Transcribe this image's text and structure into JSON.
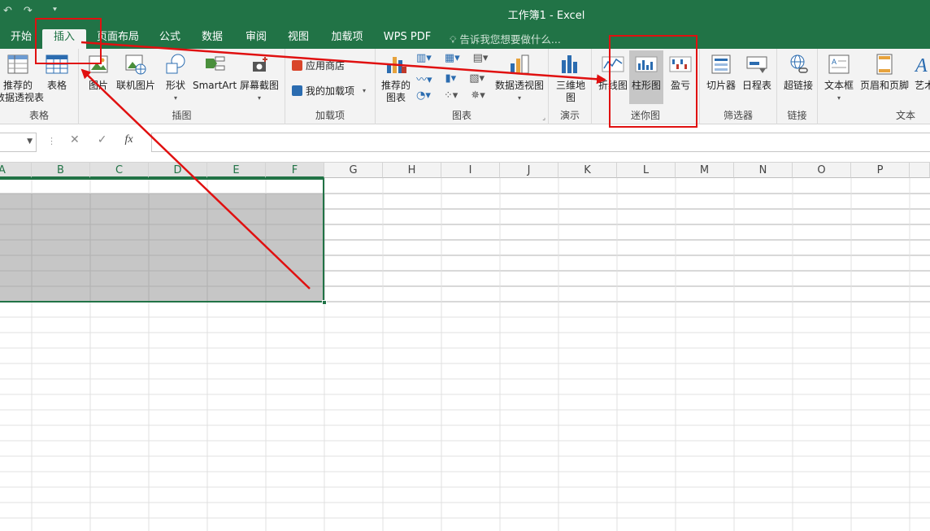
{
  "title": "工作簿1 - Excel",
  "qat": {
    "undo": "↶",
    "redo": "↷",
    "customize": "⯆"
  },
  "tabs": [
    "开始",
    "插入",
    "页面布局",
    "公式",
    "数据",
    "审阅",
    "视图",
    "加载项",
    "WPS PDF"
  ],
  "active_tab": "插入",
  "tell_me": "告诉我您想要做什么...",
  "ribbon": {
    "tables": {
      "label": "表格",
      "recommended_pivot": "推荐的\n数据透视表",
      "table": "表格"
    },
    "illustrations": {
      "label": "插图",
      "picture": "图片",
      "online_picture": "联机图片",
      "shapes": "形状",
      "smartart": "SmartArt",
      "screenshot": "屏幕截图"
    },
    "addins": {
      "label": "加载项",
      "store": "应用商店",
      "my_addins": "我的加载项"
    },
    "charts": {
      "label": "图表",
      "recommended": "推荐的\n图表",
      "pivot_chart": "数据透视图"
    },
    "tours": {
      "label": "演示",
      "map3d": "三维地\n图"
    },
    "sparklines": {
      "label": "迷你图",
      "line": "折线图",
      "column": "柱形图",
      "winloss": "盈亏"
    },
    "filters": {
      "label": "筛选器",
      "slicer": "切片器",
      "timeline": "日程表"
    },
    "links": {
      "label": "链接",
      "hyperlink": "超链接"
    },
    "text": {
      "label": "文本",
      "textbox": "文本框",
      "header_footer": "页眉和页脚",
      "wordart": "艺术"
    }
  },
  "formula_bar": {
    "name_box": "",
    "cancel": "✕",
    "enter": "✓",
    "fx": "fx",
    "value": ""
  },
  "columns": [
    "A",
    "B",
    "C",
    "D",
    "E",
    "F",
    "G",
    "H",
    "I",
    "J",
    "K",
    "L",
    "M",
    "N",
    "O",
    "P"
  ],
  "selected_columns": [
    "A",
    "B",
    "C",
    "D",
    "E",
    "F"
  ],
  "colors": {
    "brand": "#217346",
    "annotation": "#e01010",
    "selection_fill": "#c6c6c6"
  }
}
